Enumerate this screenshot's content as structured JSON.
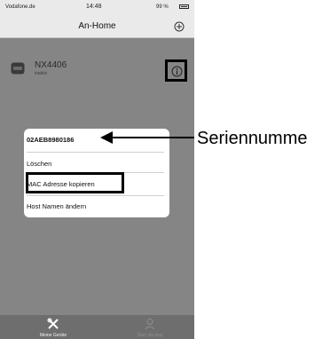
{
  "status_bar": {
    "carrier": "Vodafone.de",
    "time": "14:48",
    "battery": "99 %"
  },
  "nav": {
    "title": "An-Home",
    "add_icon": "plus-circle-icon"
  },
  "device": {
    "name": "NX4406",
    "status": "inaktiv",
    "icon": "router-icon",
    "info_icon": "info-icon"
  },
  "popup": {
    "items": [
      "02AEB8980186",
      "Löschen",
      "MAC Adresse kopieren",
      "Host Namen ändern"
    ]
  },
  "callout": {
    "label": "Seriennumme"
  },
  "tabbar": {
    "tabs": [
      {
        "label": "Meine Geräte",
        "icon": "tools-icon"
      },
      {
        "label": "Über die App",
        "icon": "person-icon"
      }
    ]
  }
}
